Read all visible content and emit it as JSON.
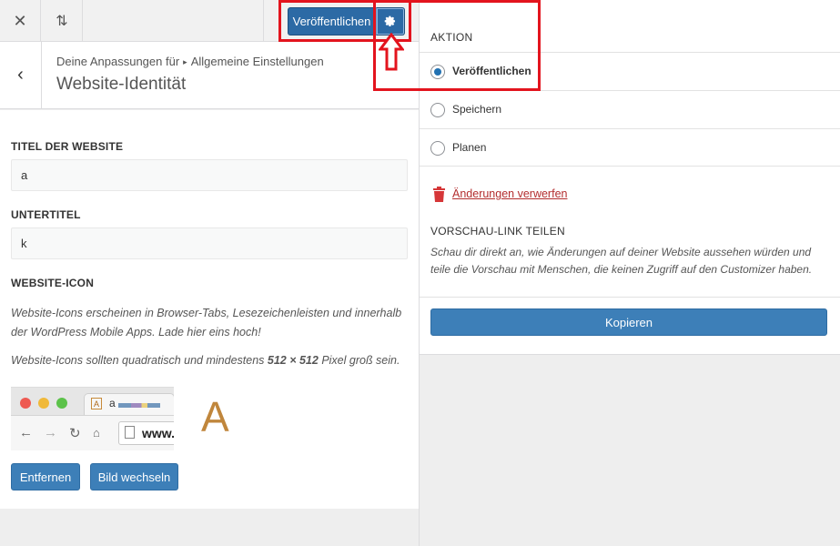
{
  "toolbar": {
    "close_icon": "close-icon",
    "sort_icon": "sort-arrows-icon",
    "publish_label": "Veröffentlichen",
    "gear_icon": "gear-icon"
  },
  "section": {
    "breadcrumb_prefix": "Deine Anpassungen für",
    "breadcrumb_current": "Allgemeine Einstellungen",
    "title": "Website-Identität"
  },
  "form": {
    "site_title_label": "TITEL DER WEBSITE",
    "site_title_value": "a",
    "tagline_label": "UNTERTITEL",
    "tagline_value": "k",
    "site_icon_label": "WEBSITE-ICON",
    "site_icon_desc": "Website-Icons erscheinen in Browser-Tabs, Lesezeichenleisten und innerhalb der WordPress Mobile Apps. Lade hier eins hoch!",
    "site_icon_size_prefix": "Website-Icons sollten quadratisch und mindestens ",
    "site_icon_size_value": "512 × 512",
    "site_icon_size_suffix": " Pixel groß sein.",
    "preview_tab_text": "a",
    "preview_url": "www.",
    "preview_icon_letter": "A",
    "large_icon_letter": "A",
    "remove_label": "Entfernen",
    "change_label": "Bild wechseln"
  },
  "publish_panel": {
    "action_label": "AKTION",
    "options": [
      {
        "label": "Veröffentlichen",
        "checked": true
      },
      {
        "label": "Speichern",
        "checked": false
      },
      {
        "label": "Planen",
        "checked": false
      }
    ],
    "discard_label": "Änderungen verwerfen",
    "share_label": "VORSCHAU-LINK TEILEN",
    "share_desc": "Schau dir direkt an, wie Änderungen auf deiner Website aussehen würden und teile die Vorschau mit Menschen, die keinen Zugriff auf den Customizer haben.",
    "copy_label": "Kopieren"
  },
  "colors": {
    "primary_button": "#3d7fb8",
    "publish_button": "#2c6aa5",
    "danger": "#b32d2e",
    "annotation": "#e3141e"
  }
}
